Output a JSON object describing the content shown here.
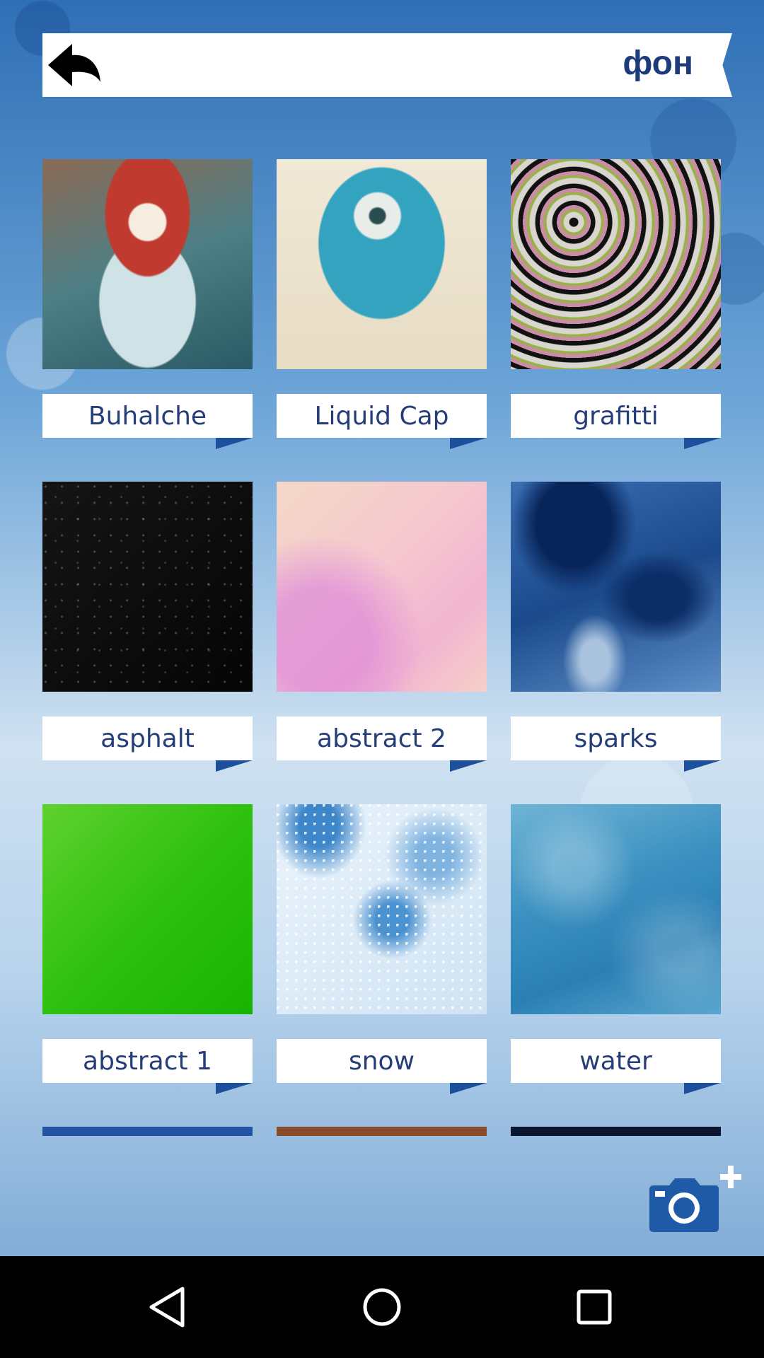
{
  "header": {
    "title": "фон",
    "back_icon": "back-arrow-icon"
  },
  "grid": {
    "items": [
      {
        "label": "Buhalche",
        "texture": "owl"
      },
      {
        "label": "Liquid Cap",
        "texture": "liquid"
      },
      {
        "label": "grafitti",
        "texture": "graffiti"
      },
      {
        "label": "asphalt",
        "texture": "asphalt"
      },
      {
        "label": "abstract 2",
        "texture": "abstract2"
      },
      {
        "label": "sparks",
        "texture": "sparks"
      },
      {
        "label": "abstract 1",
        "texture": "abstract1"
      },
      {
        "label": "snow",
        "texture": "snow"
      },
      {
        "label": "water",
        "texture": "water"
      }
    ]
  },
  "fab": {
    "icon": "camera-add-icon"
  },
  "navbar": {
    "icons": [
      "back-triangle-icon",
      "home-circle-icon",
      "recents-square-icon"
    ]
  },
  "colors": {
    "label_text": "#253e78",
    "accent": "#1c4f9c",
    "title": "#1d3b7a"
  }
}
